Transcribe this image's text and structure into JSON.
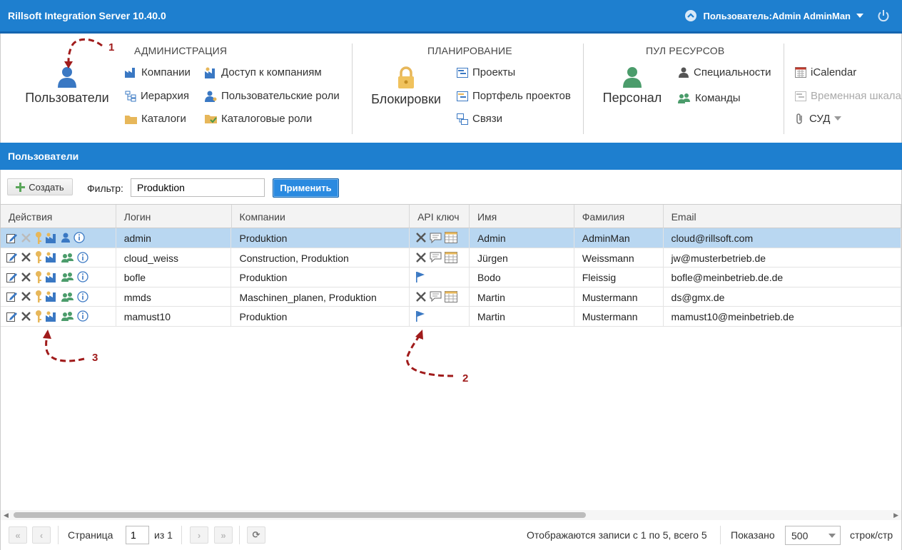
{
  "app": {
    "title": "Rillsoft Integration Server 10.40.0",
    "user_label": "Пользователь:Admin AdminMan"
  },
  "ribbon": {
    "groups": {
      "admin": "АДМИНИСТРАЦИЯ",
      "planning": "ПЛАНИРОВАНИЕ",
      "pool": "ПУЛ РЕСУРСОВ"
    },
    "users": "Пользователи",
    "companies": "Компании",
    "hierarchy": "Иерархия",
    "catalogs": "Каталоги",
    "company_access": "Доступ к компаниям",
    "user_roles": "Пользовательские роли",
    "catalog_roles": "Каталоговые роли",
    "locks": "Блокировки",
    "projects": "Проекты",
    "portfolio": "Портфель проектов",
    "links": "Связи",
    "personnel": "Персонал",
    "specialties": "Специальности",
    "teams": "Команды",
    "icalendar": "iCalendar",
    "timeline": "Временная шкала",
    "sud": "СУД"
  },
  "section": {
    "title": "Пользователи"
  },
  "toolbar": {
    "create_label": "Создать",
    "filter_label": "Фильтр:",
    "filter_value": "Produktion",
    "apply_label": "Применить"
  },
  "grid": {
    "columns": [
      "Действия",
      "Логин",
      "Компании",
      "API ключ",
      "Имя",
      "Фамилия",
      "Email"
    ],
    "rows": [
      {
        "login": "admin",
        "companies": "Produktion",
        "first": "Admin",
        "last": "AdminMan",
        "email": "cloud@rillsoft.com"
      },
      {
        "login": "cloud_weiss",
        "companies": "Construction, Produktion",
        "first": "Jürgen",
        "last": "Weissmann",
        "email": "jw@musterbetrieb.de"
      },
      {
        "login": "bofle",
        "companies": "Produktion",
        "first": "Bodo",
        "last": "Fleissig",
        "email": "bofle@meinbetrieb.de.de"
      },
      {
        "login": "mmds",
        "companies": "Maschinen_planen, Produktion",
        "first": "Martin",
        "last": "Mustermann",
        "email": "ds@gmx.de"
      },
      {
        "login": "mamust10",
        "companies": "Produktion",
        "first": "Martin",
        "last": "Mustermann",
        "email": "mamust10@meinbetrieb.de"
      }
    ]
  },
  "pager": {
    "page_label": "Страница",
    "page_value": "1",
    "of_label": "из 1",
    "records_text": "Отображаются записи с 1 по 5, всего 5",
    "shown_label": "Показано",
    "rows_value": "500",
    "rows_per_page_label": "строк/стр"
  },
  "annotations": {
    "a1": "1",
    "a2": "2",
    "a3": "3"
  },
  "colors": {
    "brand_blue": "#1e7fcf",
    "selected_row": "#b9d7f1",
    "annotation_red": "#a01b1b"
  }
}
